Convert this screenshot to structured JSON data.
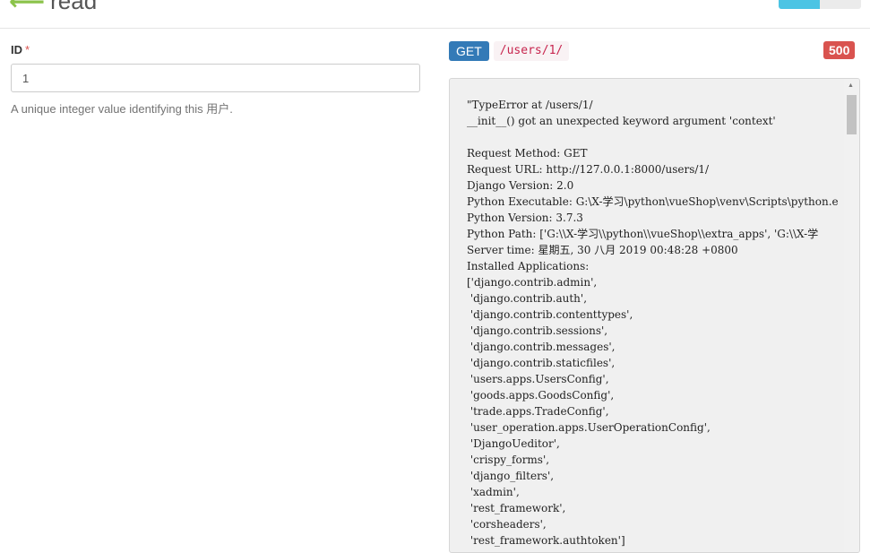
{
  "header": {
    "title": "read"
  },
  "form": {
    "id_label": "ID",
    "required_mark": "*",
    "id_value": "1",
    "id_help": "A unique integer value identifying this 用户."
  },
  "request": {
    "method": "GET",
    "url": "/users/1/",
    "status": "500"
  },
  "response": {
    "lines": [
      "\"TypeError at /users/1/",
      "__init__() got an unexpected keyword argument 'context'",
      "",
      "Request Method: GET",
      "Request URL: http://127.0.0.1:8000/users/1/",
      "Django Version: 2.0",
      "Python Executable: G:\\X-学习\\python\\vueShop\\venv\\Scripts\\python.e",
      "Python Version: 3.7.3",
      "Python Path: ['G:\\\\X-学习\\\\python\\\\vueShop\\\\extra_apps', 'G:\\\\X-学",
      "Server time: 星期五, 30 八月 2019 00:48:28 +0800",
      "Installed Applications:",
      "['django.contrib.admin',",
      " 'django.contrib.auth',",
      " 'django.contrib.contenttypes',",
      " 'django.contrib.sessions',",
      " 'django.contrib.messages',",
      " 'django.contrib.staticfiles',",
      " 'users.apps.UsersConfig',",
      " 'goods.apps.GoodsConfig',",
      " 'trade.apps.TradeConfig',",
      " 'user_operation.apps.UserOperationConfig',",
      " 'DjangoUeditor',",
      " 'crispy_forms',",
      " 'django_filters',",
      " 'xadmin',",
      " 'rest_framework',",
      " 'corsheaders',",
      " 'rest_framework.authtoken']"
    ]
  }
}
